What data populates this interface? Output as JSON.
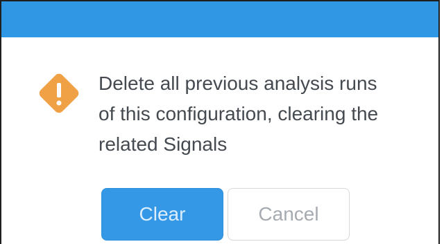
{
  "dialog": {
    "message": "Delete all previous analysis runs\nof this configuration, clearing the\nrelated Signals",
    "icon": "warning-icon",
    "colors": {
      "header": "#2f97e3",
      "warning": "#f0a145",
      "primary_button": "#3598e6"
    }
  },
  "actions": {
    "clear_label": "Clear",
    "cancel_label": "Cancel"
  }
}
